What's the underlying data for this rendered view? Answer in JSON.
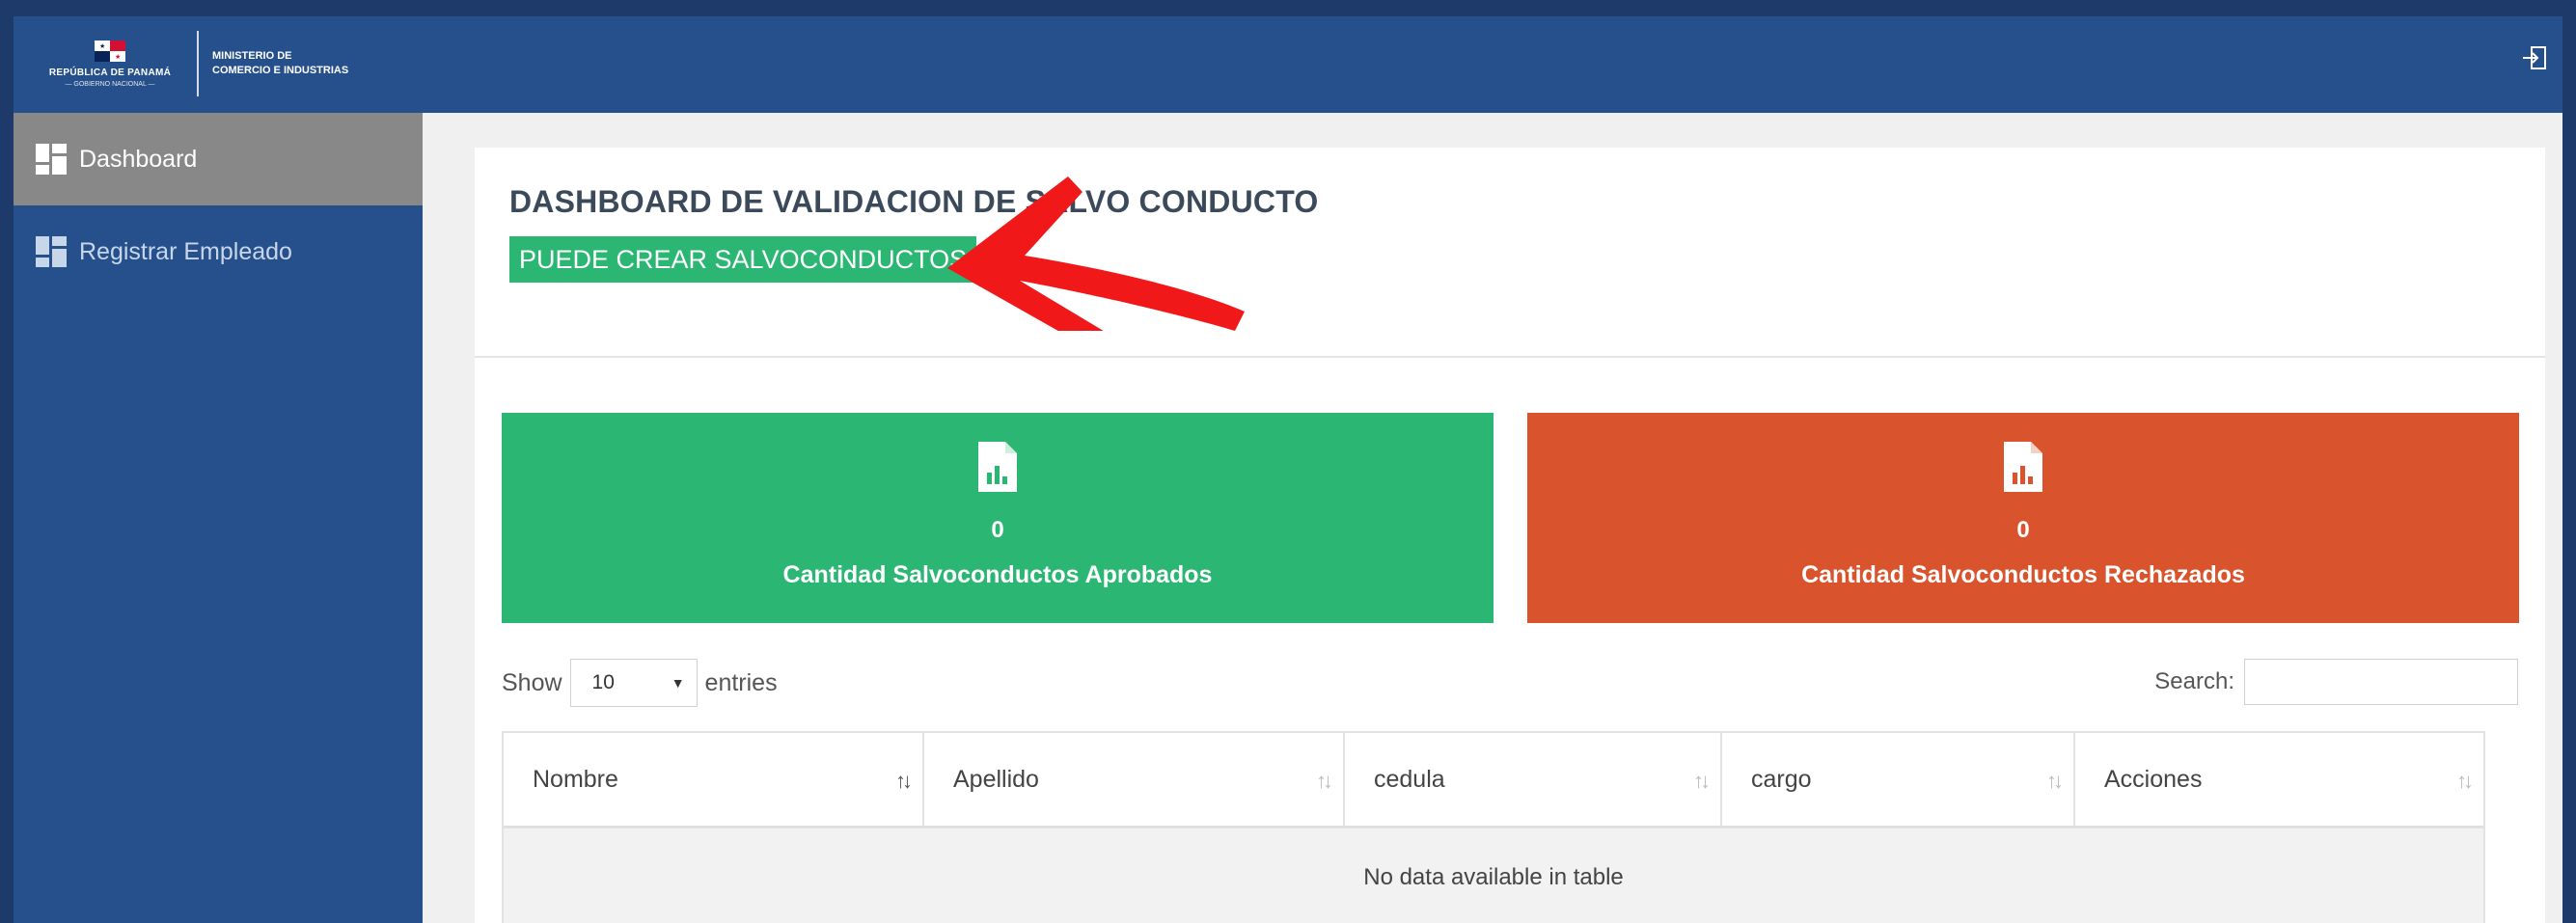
{
  "header": {
    "logo_left_line1": "REPÚBLICA DE PANAMÁ",
    "logo_left_line2": "— GOBIERNO NACIONAL —",
    "logo_right_line1": "MINISTERIO DE",
    "logo_right_line2": "COMERCIO E INDUSTRIAS",
    "logout_icon": "logout-icon"
  },
  "sidebar": {
    "items": [
      {
        "label": "Dashboard",
        "icon": "dashboard-icon",
        "active": true
      },
      {
        "label": "Registrar Empleado",
        "icon": "dashboard-icon",
        "active": false
      }
    ]
  },
  "main": {
    "title": "DASHBOARD DE VALIDACION DE SALVO CONDUCTO",
    "status_badge": "PUEDE CREAR SALVOCONDUCTOS",
    "stats": [
      {
        "value": "0",
        "label": "Cantidad Salvoconductos Aprobados",
        "color": "#2bb673",
        "icon": "file-chart-icon"
      },
      {
        "value": "0",
        "label": "Cantidad Salvoconductos Rechazados",
        "color": "#d9542c",
        "icon": "file-chart-icon"
      }
    ],
    "table": {
      "length_prefix": "Show",
      "length_value": "10",
      "length_suffix": "entries",
      "search_label": "Search:",
      "search_value": "",
      "columns": [
        "Nombre",
        "Apellido",
        "cedula",
        "cargo",
        "Acciones"
      ],
      "empty_message": "No data available in table"
    }
  },
  "colors": {
    "header_bg": "#26508c",
    "sidebar_active": "#888888",
    "success": "#2bb673",
    "danger": "#d9542c",
    "annotation_arrow": "#f01818"
  }
}
